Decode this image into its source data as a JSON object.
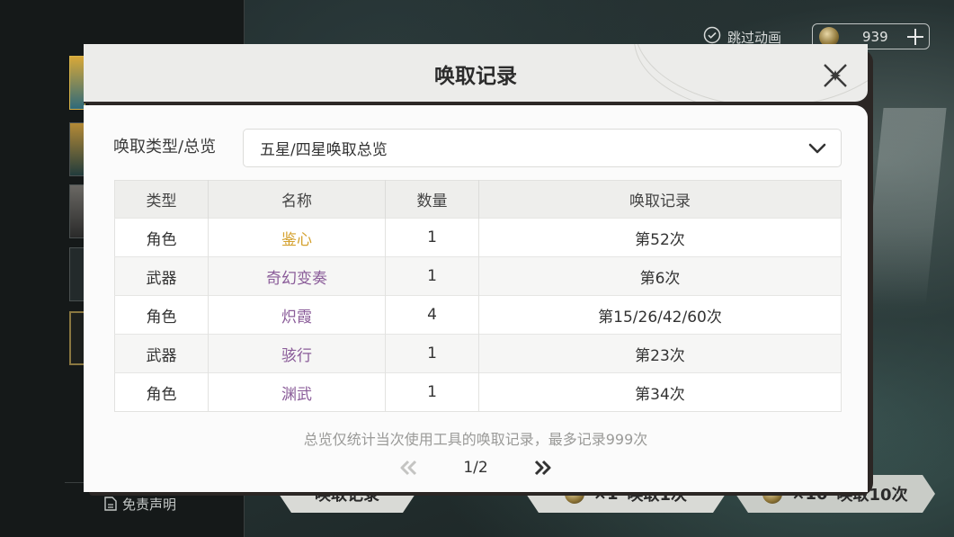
{
  "hud": {
    "skip_label": "跳过动画",
    "currency_amount": "939"
  },
  "left_panel": {
    "disclaimer_label": "免责声明"
  },
  "bottom_bar": {
    "record_button_label": "唤取记录",
    "single_count": "×1",
    "single_label": "唤取1次",
    "ten_count": "×10",
    "ten_label": "唤取10次"
  },
  "modal": {
    "title": "唤取记录",
    "filter_label": "唤取类型/总览",
    "filter_value": "五星/四星唤取总览",
    "columns": [
      "类型",
      "名称",
      "数量",
      "唤取记录"
    ],
    "rows": [
      {
        "type": "角色",
        "name": "鉴心",
        "name_color": "#d4a12e",
        "qty": "1",
        "record": "第52次"
      },
      {
        "type": "武器",
        "name": "奇幻变奏",
        "name_color": "#8a5c99",
        "qty": "1",
        "record": "第6次"
      },
      {
        "type": "角色",
        "name": "炽霞",
        "name_color": "#8a5c99",
        "qty": "4",
        "record": "第15/26/42/60次"
      },
      {
        "type": "武器",
        "name": "骇行",
        "name_color": "#8a5c99",
        "qty": "1",
        "record": "第23次"
      },
      {
        "type": "角色",
        "name": "渊武",
        "name_color": "#8a5c99",
        "qty": "1",
        "record": "第34次"
      }
    ],
    "footnote": "总览仅统计当次使用工具的唤取记录，最多记录999次",
    "pagination": "1/2"
  }
}
